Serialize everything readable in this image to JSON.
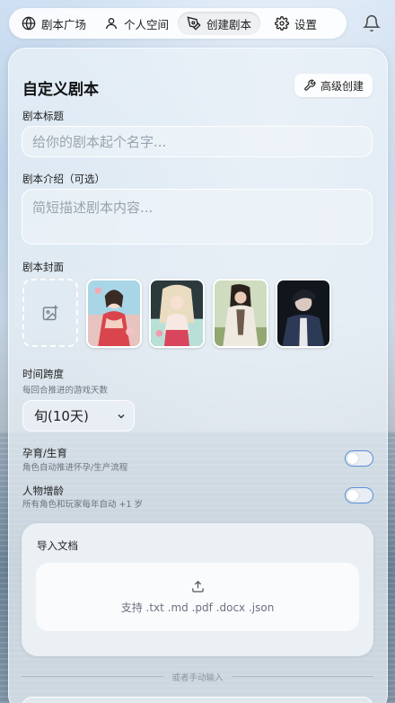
{
  "nav": {
    "items": [
      {
        "label": "剧本广场",
        "icon": "globe-icon"
      },
      {
        "label": "个人空间",
        "icon": "user-icon"
      },
      {
        "label": "创建剧本",
        "icon": "pen-tool-icon",
        "active": true
      },
      {
        "label": "设置",
        "icon": "gear-icon"
      }
    ],
    "notification_icon": "bell-icon"
  },
  "form": {
    "title": "自定义剧本",
    "advanced_button": "高级创建",
    "script_title": {
      "label": "剧本标题",
      "placeholder": "给你的剧本起个名字..."
    },
    "script_intro": {
      "label": "剧本介绍（可选）",
      "placeholder": "简短描述剧本内容..."
    },
    "cover": {
      "label": "剧本封面",
      "thumbnails": [
        "cover-1",
        "cover-2",
        "cover-3",
        "cover-4"
      ]
    },
    "time_span": {
      "label": "时间跨度",
      "description": "每回合推进的游戏天数",
      "selected": "旬(10天)"
    },
    "pregnancy": {
      "label": "孕育/生育",
      "description": "角色自动推进怀孕/生产流程"
    },
    "aging": {
      "label": "人物增龄",
      "description": "所有角色和玩家每年自动 +1 岁"
    },
    "import": {
      "title": "导入文档",
      "hint": "支持 .txt .md .pdf .docx .json"
    },
    "divider_text": "或者手动输入"
  },
  "colors": {
    "accent": "#5b8fd8",
    "card": "#ecf2f8"
  }
}
